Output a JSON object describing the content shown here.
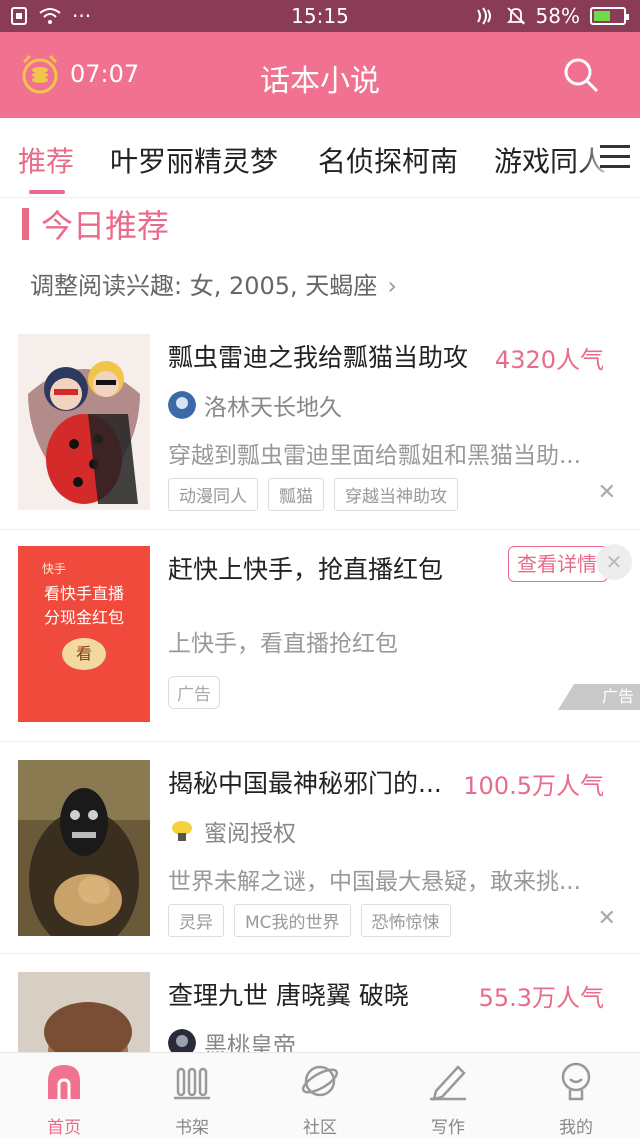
{
  "status_bar": {
    "time": "15:15",
    "battery": "58%",
    "battery_level": 0.58,
    "dots": "···"
  },
  "header": {
    "clock_time": "07:07",
    "title": "话本小说"
  },
  "tabs": [
    {
      "label": "推荐",
      "active": true
    },
    {
      "label": "叶罗丽精灵梦",
      "active": false
    },
    {
      "label": "名侦探柯南",
      "active": false
    },
    {
      "label": "游戏同人",
      "active": false
    }
  ],
  "section": {
    "title": "今日推荐",
    "interest": "调整阅读兴趣: 女, 2005, 天蝎座"
  },
  "items": [
    {
      "title": "瓢虫雷迪之我给瓢猫当助攻",
      "popularity": "4320人气",
      "author": "洛林天长地久",
      "desc": "穿越到瓢虫雷迪里面给瓢姐和黑猫当助...",
      "tags": [
        "动漫同人",
        "瓢猫",
        "穿越当神助攻"
      ]
    },
    {
      "title": "揭秘中国最神秘邪门的...",
      "popularity": "100.5万人气",
      "author": "蜜阅授权",
      "desc": "世界未解之谜，中国最大悬疑，敢来挑...",
      "tags": [
        "灵异",
        "MC我的世界",
        "恐怖惊悚"
      ]
    },
    {
      "title": "查理九世 唐晓翼 破晓",
      "popularity": "55.3万人气",
      "author": "黑桃皇帝"
    }
  ],
  "ad": {
    "title": "赶快上快手，抢直播红包",
    "button": "查看详情",
    "desc": "上快手，看直播抢红包",
    "tag": "广告",
    "corner": "广告",
    "cover_brand": "快手",
    "cover_line1": "看快手直播",
    "cover_line2": "分现金红包",
    "cover_button": "看"
  },
  "bottom_nav": [
    {
      "label": "首页",
      "active": true
    },
    {
      "label": "书架",
      "active": false
    },
    {
      "label": "社区",
      "active": false
    },
    {
      "label": "写作",
      "active": false
    },
    {
      "label": "我的",
      "active": false
    }
  ],
  "colors": {
    "accent": "#e96b8a",
    "header": "#f07290",
    "statusbar": "#8a3b55"
  }
}
